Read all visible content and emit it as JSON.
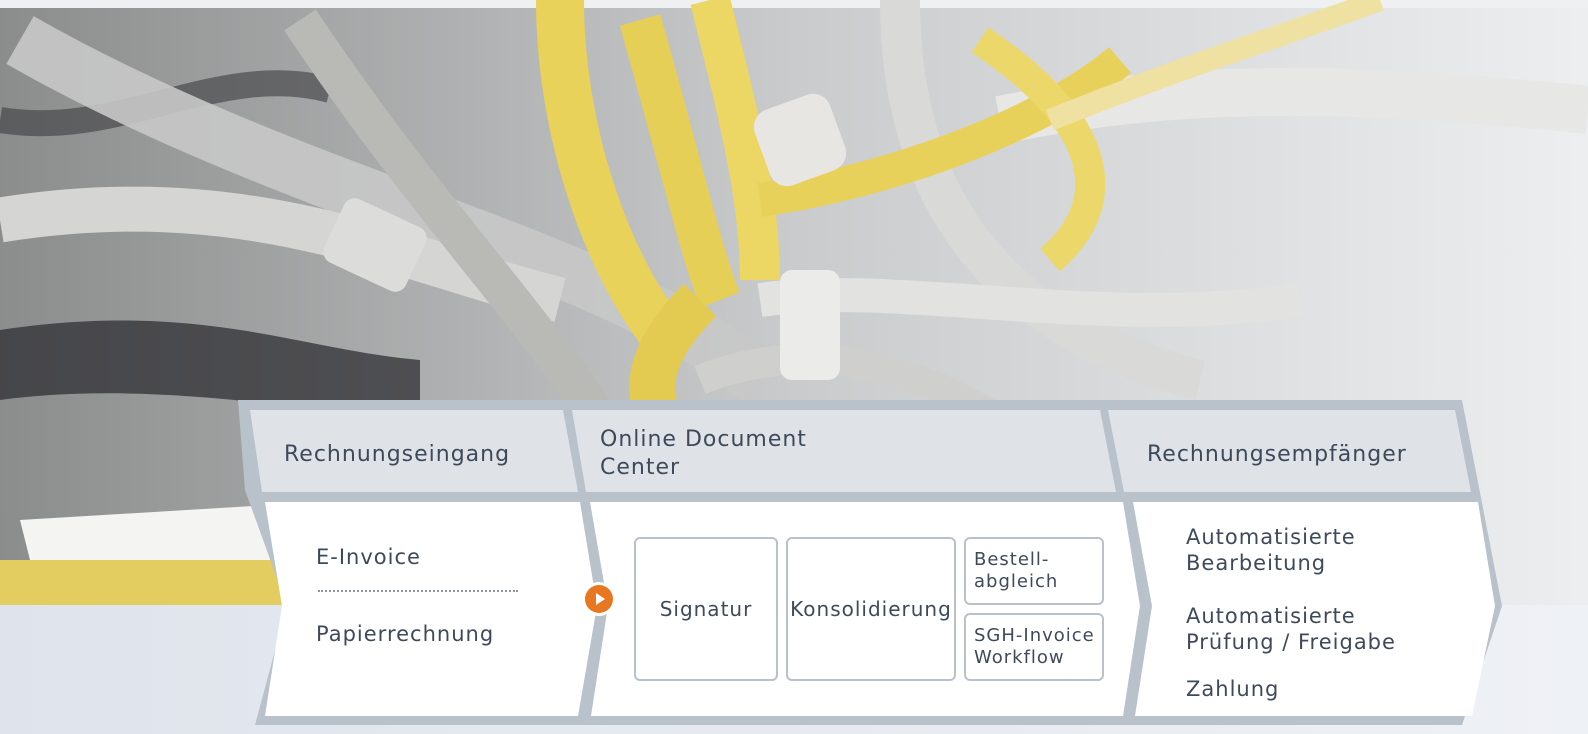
{
  "header": {
    "col1": "Rechnungseingang",
    "col2_line1": "Online Document",
    "col2_line2": "Center",
    "col3": "Rechnungsempfänger"
  },
  "inputs": {
    "item1": "E-Invoice",
    "item2": "Papierrechnung"
  },
  "process": {
    "signatur": "Signatur",
    "konsolidierung": "Konsolidierung",
    "bestell_line1": "Bestell-",
    "bestell_line2": "abgleich",
    "sgh_line1": "SGH-Invoice",
    "sgh_line2": "Workflow"
  },
  "outputs": {
    "item1_line1": "Automatisierte",
    "item1_line2": "Bearbeitung",
    "item2_line1": "Automatisierte",
    "item2_line2": "Prüfung / Freigabe",
    "item3": "Zahlung"
  },
  "colors": {
    "frame": "#b9c1cb",
    "header_fill": "#dfe3e8",
    "text": "#3e4a5a",
    "accent": "#e87722"
  },
  "background": {
    "description_icon": "network-cables-photo"
  }
}
